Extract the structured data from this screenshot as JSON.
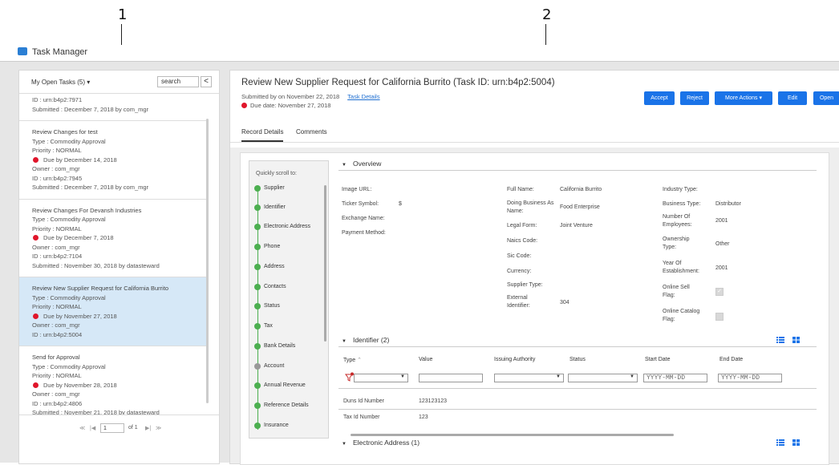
{
  "callouts": {
    "one": "1",
    "two": "2"
  },
  "app": {
    "title": "Task Manager"
  },
  "left": {
    "header": "My Open Tasks (5) ▾",
    "search_placeholder": "search",
    "collapse": "<",
    "tasks": [
      {
        "lines": [
          "ID : urn:b4p2:7971",
          "Submitted : December 7, 2018 by com_mgr"
        ]
      },
      {
        "title": "Review Changes for test",
        "type": "Type : Commodity Approval",
        "priority": "Priority : NORMAL",
        "due": "Due by December 14, 2018",
        "owner": "Owner : com_mgr",
        "id": "ID : urn:b4p2:7945",
        "submitted": "Submitted : December 7, 2018 by com_mgr"
      },
      {
        "title": "Review Changes For Devansh Industries",
        "type": "Type : Commodity Approval",
        "priority": "Priority : NORMAL",
        "due": "Due by December 7, 2018",
        "owner": "Owner : com_mgr",
        "id": "ID : urn:b4p2:7104",
        "submitted": "Submitted : November 30, 2018 by datasteward"
      },
      {
        "title": "Review New Supplier Request for California Burrito",
        "type": "Type : Commodity Approval",
        "priority": "Priority : NORMAL",
        "due": "Due by November 27, 2018",
        "owner": "Owner : com_mgr",
        "id": "ID : urn:b4p2:5004"
      },
      {
        "title": "Send for Approval",
        "type": "Type : Commodity Approval",
        "priority": "Priority : NORMAL",
        "due": "Due by November 28, 2018",
        "owner": "Owner : com_mgr",
        "id": "ID : urn:b4p2:4806",
        "submitted": "Submitted : November 21, 2018 by datasteward"
      }
    ],
    "pager": {
      "first": "≪",
      "prev": "|◀",
      "page": "1",
      "of": "of 1",
      "next": "▶|",
      "last": "≫"
    }
  },
  "right": {
    "title": "Review New Supplier Request for California Burrito (Task ID: urn:b4p2:5004)",
    "submitted": "Submitted by on November 22, 2018",
    "task_details": "Task Details",
    "due": "Due date: November 27, 2018",
    "buttons": {
      "accept": "Accept",
      "reject": "Reject",
      "more": "More Actions  ▾",
      "edit": "Edit",
      "open": "Open"
    },
    "tabs": {
      "record": "Record Details",
      "comments": "Comments"
    },
    "nav": {
      "quick": "Quickly scroll to:",
      "items": [
        "Supplier",
        "Identifier",
        "Electronic Address",
        "Phone",
        "Address",
        "Contacts",
        "Status",
        "Tax",
        "Bank Details",
        "Account",
        "Annual Revenue",
        "Reference Details",
        "Insurance"
      ]
    },
    "overview": {
      "title": "Overview",
      "col1": [
        [
          "Image URL:",
          ""
        ],
        [
          "Ticker Symbol:",
          "$"
        ],
        [
          "Exchange Name:",
          ""
        ],
        [
          "Payment Method:",
          ""
        ]
      ],
      "col2": [
        [
          "Full Name:",
          "California Burrito"
        ],
        [
          "Doing Business As Name:",
          "Food Enterprise"
        ],
        [
          "Legal Form:",
          "Joint Venture"
        ],
        [
          "Naics Code:",
          ""
        ],
        [
          "Sic Code:",
          ""
        ],
        [
          "Currency:",
          ""
        ],
        [
          "Supplier Type:",
          ""
        ],
        [
          "External Identifier:",
          "304"
        ]
      ],
      "col3": [
        [
          "Industry Type:",
          ""
        ],
        [
          "Business Type:",
          "Distributor"
        ],
        [
          "Number Of Employees:",
          "2001"
        ],
        [
          "Ownership Type:",
          "Other"
        ],
        [
          "Year Of Establishment:",
          "2001"
        ],
        [
          "Online Sell Flag:",
          ""
        ],
        [
          "Online Catalog Flag:",
          ""
        ]
      ]
    },
    "identifier": {
      "title": "Identifier (2)",
      "headers": [
        "Type",
        "Value",
        "Issuing Authority",
        "Status",
        "Start Date",
        "End Date"
      ],
      "date_placeholder": "YYYY-MM-DD",
      "rows": [
        [
          "Duns Id Number",
          "123123123"
        ],
        [
          "Tax Id Number",
          "123"
        ]
      ]
    },
    "electronic": {
      "title": "Electronic Address (1)"
    }
  }
}
